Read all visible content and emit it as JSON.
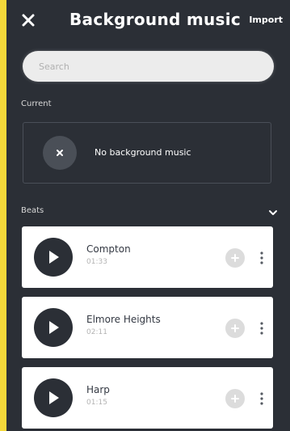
{
  "header": {
    "title": "Background music",
    "import_label": "Import",
    "close_icon": "close-icon"
  },
  "search": {
    "placeholder": "Search"
  },
  "current": {
    "label": "Current",
    "text": "No background music",
    "clear_icon": "close-icon"
  },
  "beats": {
    "label": "Beats",
    "toggle_icon": "chevron-down-icon",
    "tracks": [
      {
        "name": "Compton",
        "duration": "01:33"
      },
      {
        "name": "Elmore Heights",
        "duration": "02:11"
      },
      {
        "name": "Harp",
        "duration": "01:15"
      }
    ]
  },
  "colors": {
    "frame": "#f4d83a",
    "background": "#2b2f36",
    "card": "#ffffff",
    "play_button": "#2b2f36"
  }
}
